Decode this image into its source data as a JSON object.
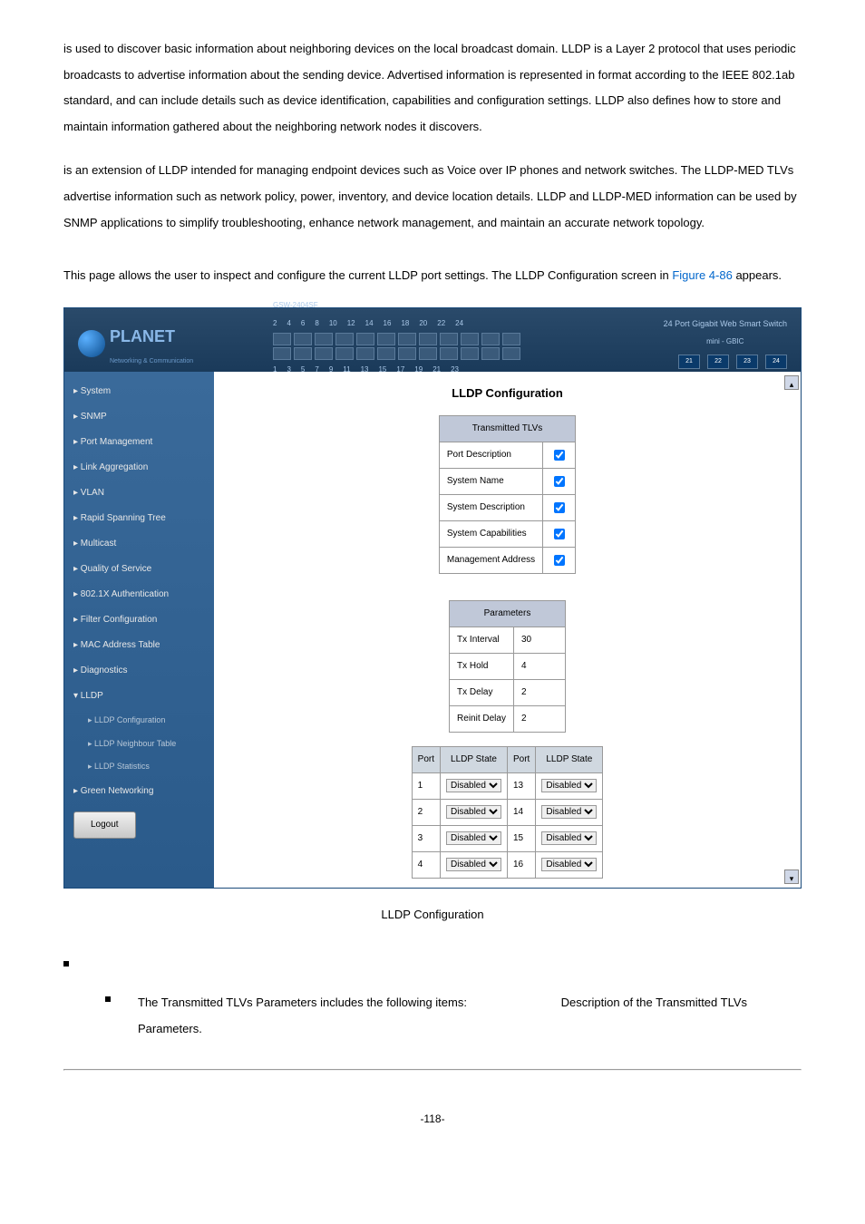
{
  "p1_frag1": " is used to discover basic information about neighboring devices on the local broadcast domain. LLDP is a Layer 2 protocol that uses periodic broadcasts to advertise information about the sending device. Advertised information is represented in ",
  "p1_frag2": " format according to the IEEE 802.1ab standard, and can include details such as device identification, capabilities and configuration settings. LLDP also defines how to store and maintain information gathered about the neighboring network nodes it discovers.",
  "p2_frag1": " is an extension of LLDP intended for managing endpoint devices such as Voice over IP phones and network switches. The LLDP-MED TLVs advertise information such as network policy, power, inventory, and device location details. LLDP and LLDP-MED information can be used by SNMP applications to simplify troubleshooting, enhance network management, and maintain an accurate network topology.",
  "p3_a": "This page allows the user to inspect and configure the current LLDP port settings. The LLDP Configuration screen in ",
  "p3_link": "Figure 4-86",
  "p3_b": " appears.",
  "model": "GSW-2404SF",
  "logo_text": "PLANET",
  "logo_sub": "Networking & Communication",
  "head_right": "24 Port Gigabit Web Smart Switch",
  "head_right2": "mini - GBIC",
  "gbic": [
    "21",
    "22",
    "23",
    "24"
  ],
  "top_nums": [
    "2",
    "4",
    "6",
    "8",
    "10",
    "12",
    "14",
    "16",
    "18",
    "20",
    "22",
    "24"
  ],
  "bot_nums": [
    "1",
    "3",
    "5",
    "7",
    "9",
    "11",
    "13",
    "15",
    "17",
    "19",
    "21",
    "23"
  ],
  "nav": {
    "system": "▸ System",
    "snmp": "▸ SNMP",
    "portmgmt": "▸ Port Management",
    "linkagg": "▸ Link Aggregation",
    "vlan": "▸ VLAN",
    "rstp": "▸ Rapid Spanning Tree",
    "multicast": "▸ Multicast",
    "qos": "▸ Quality of Service",
    "dot1x": "▸ 802.1X Authentication",
    "filter": "▸ Filter Configuration",
    "mac": "▸ MAC Address Table",
    "diag": "▸ Diagnostics",
    "lldp": "▾ LLDP",
    "lldp_cfg": "▸ LLDP Configuration",
    "lldp_nbr": "▸ LLDP Neighbour Table",
    "lldp_stat": "▸ LLDP Statistics",
    "green": "▸ Green Networking",
    "logout": "Logout"
  },
  "content_title": "LLDP Configuration",
  "tlv_header": "Transmitted TLVs",
  "tlv_rows": {
    "pd": "Port Description",
    "sn": "System Name",
    "sd": "System Description",
    "sc": "System Capabilities",
    "ma": "Management Address"
  },
  "param_header": "Parameters",
  "params": {
    "txi_l": "Tx Interval",
    "txi_v": "30",
    "txh_l": "Tx Hold",
    "txh_v": "4",
    "txd_l": "Tx Delay",
    "txd_v": "2",
    "rd_l": "Reinit Delay",
    "rd_v": "2"
  },
  "pt_h1": "Port",
  "pt_h2": "LLDP State",
  "pt_h3": "Port",
  "pt_h4": "LLDP State",
  "pt": [
    {
      "a": "1",
      "as": "Disabled",
      "b": "13",
      "bs": "Disabled"
    },
    {
      "a": "2",
      "as": "Disabled",
      "b": "14",
      "bs": "Disabled"
    },
    {
      "a": "3",
      "as": "Disabled",
      "b": "15",
      "bs": "Disabled"
    },
    {
      "a": "4",
      "as": "Disabled",
      "b": "16",
      "bs": "Disabled"
    }
  ],
  "caption": " LLDP Configuration",
  "bullet_text": "The Transmitted TLVs Parameters includes the following items:",
  "bullet_desc": "Description of the Transmitted TLVs Parameters.",
  "footer": "-118-"
}
